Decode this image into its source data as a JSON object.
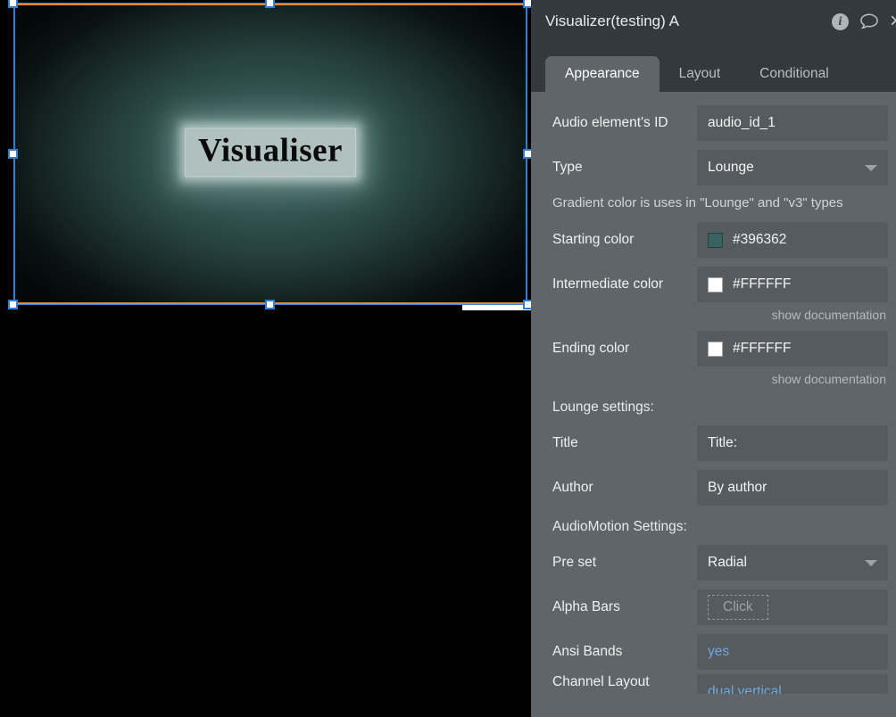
{
  "stage": {
    "canvas_label": "Visualiser",
    "canvas_gradient_center": "#3a5f5b",
    "canvas_gradient_edge": "#030708",
    "selection_accent": "#2b7fd4",
    "selection_edge": "#e08a2e"
  },
  "panel": {
    "header": {
      "title": "Visualizer(testing) A",
      "info_icon": "info-icon",
      "chat_icon": "comment-icon",
      "close_icon": "close-icon",
      "close_glyph": "×",
      "info_glyph": "i"
    },
    "tabs": [
      {
        "label": "Appearance",
        "active": true
      },
      {
        "label": "Layout",
        "active": false
      },
      {
        "label": "Conditional",
        "active": false
      }
    ],
    "fields": {
      "audio_id": {
        "label": "Audio element's ID",
        "value": "audio_id_1"
      },
      "type": {
        "label": "Type",
        "value": "Lounge"
      },
      "gradient_note": "Gradient color is uses in \"Lounge\" and \"v3\" types",
      "starting_color": {
        "label": "Starting color",
        "value": "#396362",
        "swatch": "#396362"
      },
      "intermediate_color": {
        "label": "Intermediate color",
        "value": "#FFFFFF",
        "swatch": "#FFFFFF"
      },
      "ending_color": {
        "label": "Ending color",
        "value": "#FFFFFF",
        "swatch": "#FFFFFF"
      },
      "doc_link_1": "show documentation",
      "doc_link_2": "show documentation",
      "lounge_heading": "Lounge settings:",
      "title": {
        "label": "Title",
        "value": "Title:"
      },
      "author": {
        "label": "Author",
        "value": "By author"
      },
      "audiomotion_heading": "AudioMotion Settings:",
      "preset": {
        "label": "Pre set",
        "value": "Radial"
      },
      "alpha_bars": {
        "label": "Alpha Bars",
        "value": "Click"
      },
      "ansi_bands": {
        "label": "Ansi Bands",
        "value": "yes"
      },
      "channel_layout": {
        "label": "Channel Layout",
        "value": "dual vertical"
      }
    }
  }
}
